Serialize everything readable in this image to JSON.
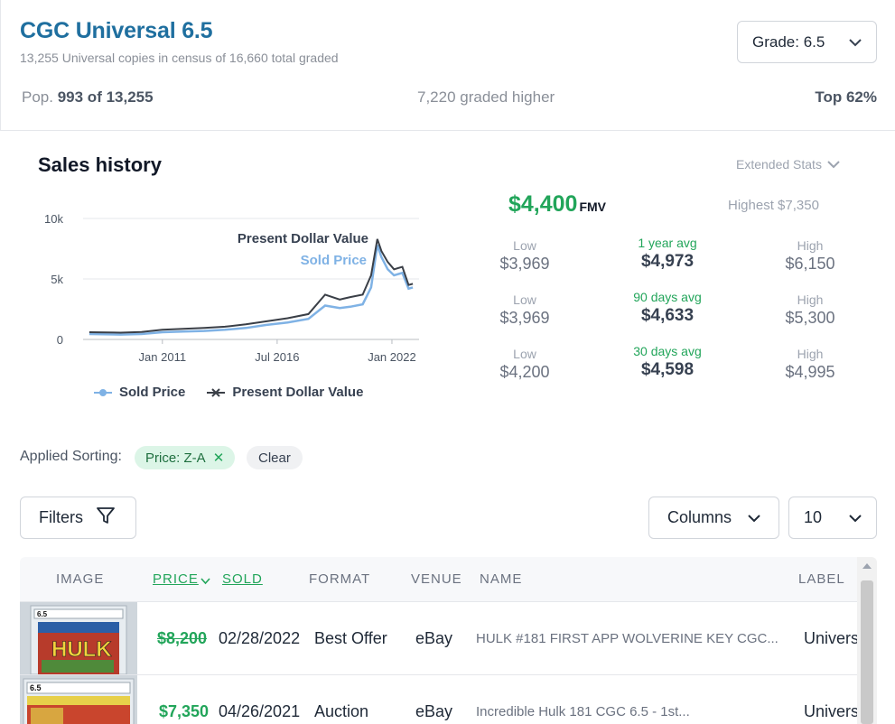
{
  "header": {
    "title": "CGC Universal 6.5",
    "census": "13,255 Universal copies in census of 16,660 total graded",
    "grade_select": "Grade: 6.5",
    "pop_label": "Pop.",
    "pop_value": "993 of 13,255",
    "graded_higher": "7,220 graded higher",
    "top_pct": "Top 62%"
  },
  "sales": {
    "title": "Sales history",
    "extended_stats": "Extended Stats",
    "fmv_value": "$4,400",
    "fmv_label": "FMV",
    "highest": "Highest $7,350",
    "stats": [
      {
        "low_label": "Low",
        "low": "$3,969",
        "avg_label": "1 year avg",
        "avg": "$4,973",
        "high_label": "High",
        "high": "$6,150"
      },
      {
        "low_label": "Low",
        "low": "$3,969",
        "avg_label": "90 days avg",
        "avg": "$4,633",
        "high_label": "High",
        "high": "$5,300"
      },
      {
        "low_label": "Low",
        "low": "$4,200",
        "avg_label": "30 days avg",
        "avg": "$4,598",
        "high_label": "High",
        "high": "$4,995"
      }
    ]
  },
  "chart_data": {
    "type": "line",
    "y_ticks": [
      "10k",
      "5k",
      "0"
    ],
    "ylim": [
      0,
      10000
    ],
    "x_ticks": [
      "Jan 2011",
      "Jul 2016",
      "Jan 2022"
    ],
    "annotations": [
      "Present Dollar Value",
      "Sold Price"
    ],
    "series": [
      {
        "name": "Sold Price",
        "color": "#7fb2e5",
        "x": [
          2007.5,
          2009,
          2010,
          2011,
          2012,
          2013,
          2014,
          2015,
          2016,
          2017,
          2018,
          2018.8,
          2019.5,
          2020,
          2020.6,
          2021,
          2021.3,
          2021.5,
          2021.8,
          2022.1,
          2022.5,
          2022.8,
          2023
        ],
        "y": [
          450,
          400,
          450,
          600,
          650,
          700,
          800,
          950,
          1200,
          1400,
          1700,
          2800,
          2600,
          2700,
          2900,
          4300,
          7800,
          6800,
          5800,
          5300,
          5500,
          4200,
          4300
        ]
      },
      {
        "name": "Present Dollar Value",
        "color": "#3a3f47",
        "x": [
          2007.5,
          2009,
          2010,
          2011,
          2012,
          2013,
          2014,
          2015,
          2016,
          2017,
          2018,
          2018.8,
          2019.5,
          2020,
          2020.6,
          2021,
          2021.3,
          2021.5,
          2021.8,
          2022.1,
          2022.5,
          2022.8,
          2023
        ],
        "y": [
          600,
          560,
          620,
          800,
          880,
          950,
          1050,
          1250,
          1500,
          1750,
          2100,
          3700,
          3300,
          3500,
          3700,
          5300,
          8300,
          7300,
          6400,
          5800,
          6000,
          4500,
          4600
        ]
      }
    ],
    "legend": [
      "Sold Price",
      "Present Dollar Value"
    ]
  },
  "sorting": {
    "label": "Applied Sorting:",
    "chip": "Price: Z-A",
    "clear": "Clear"
  },
  "controls": {
    "filters": "Filters",
    "columns": "Columns",
    "per_page": "10"
  },
  "table": {
    "headers": {
      "image": "IMAGE",
      "price": "PRICE",
      "sold": "SOLD",
      "format": "FORMAT",
      "venue": "VENUE",
      "name": "NAME",
      "label": "LABEL"
    },
    "rows": [
      {
        "price": "$8,200",
        "sold": "02/28/2022",
        "format": "Best Offer",
        "venue": "eBay",
        "name": "HULK #181 FIRST APP WOLVERINE KEY CGC...",
        "label": "Univers",
        "strike": true,
        "thumb_grade": "6.5"
      },
      {
        "price": "$7,350",
        "sold": "04/26/2021",
        "format": "Auction",
        "venue": "eBay",
        "name": "Incredible Hulk 181 CGC 6.5 - 1st...",
        "label": "Univers",
        "strike": false,
        "thumb_grade": "6.5"
      }
    ]
  }
}
